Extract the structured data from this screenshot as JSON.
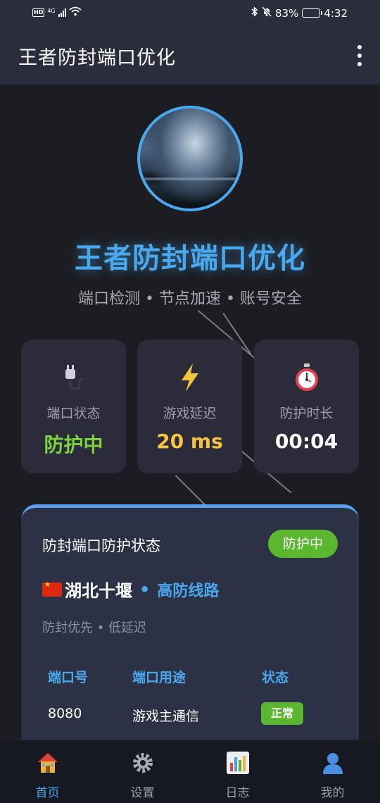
{
  "status_bar": {
    "network": "4G",
    "battery": "83%",
    "battery_level": 0.83,
    "time": "4:32"
  },
  "app_bar": {
    "title": "王者防封端口优化",
    "more_icon": "more-vertical-icon"
  },
  "hero": {
    "title": "王者防封端口优化",
    "subtitle": "端口检测 • 节点加速 • 账号安全"
  },
  "stats": [
    {
      "icon": "plug-icon",
      "glyph": "🔌",
      "label": "端口状态",
      "value": "防护中",
      "color": "#7ad33f"
    },
    {
      "icon": "lightning-icon",
      "glyph": "⚡",
      "label": "游戏延迟",
      "value": "20 ms",
      "color": "#f5c542"
    },
    {
      "icon": "stopwatch-icon",
      "glyph": "⏱",
      "label": "防护时长",
      "value": "00:04",
      "color": "#ffffff"
    }
  ],
  "protection_card": {
    "title": "防封端口防护状态",
    "badge": "防护中",
    "location": "湖北十堰",
    "separator": "•",
    "line_type": "高防线路",
    "tags": "防封优先 • 低延迟",
    "columns": [
      "端口号",
      "端口用途",
      "状态"
    ],
    "rows": [
      {
        "port": "8080",
        "usage": "游戏主通信",
        "status": "正常"
      }
    ]
  },
  "bottom_nav": [
    {
      "icon": "home-icon",
      "glyph": "🏠",
      "label": "首页",
      "active": true
    },
    {
      "icon": "gear-icon",
      "glyph": "⚙",
      "label": "设置",
      "active": false
    },
    {
      "icon": "chart-icon",
      "glyph": "📊",
      "label": "日志",
      "active": false
    },
    {
      "icon": "user-icon",
      "glyph": "👤",
      "label": "我的",
      "active": false
    }
  ]
}
